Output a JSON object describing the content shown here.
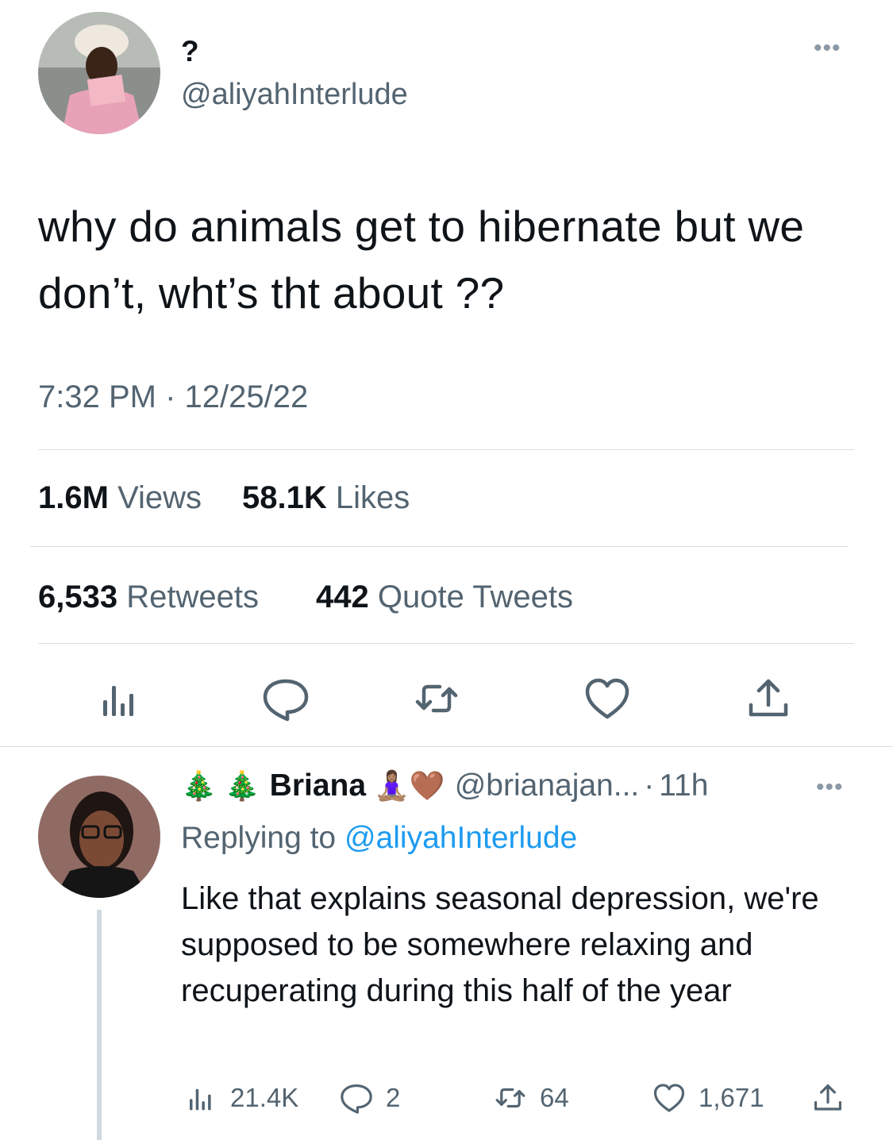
{
  "main_tweet": {
    "display_name": "?",
    "handle": "@aliyahInterlude",
    "text": "why do animals get to hibernate but we don’t, wht’s tht about ??",
    "time": "7:32 PM",
    "date": "12/25/22",
    "meta_separator": "·",
    "stats": {
      "views_count": "1.6M",
      "views_label": "Views",
      "likes_count": "58.1K",
      "likes_label": "Likes",
      "retweets_count": "6,533",
      "retweets_label": "Retweets",
      "quotes_count": "442",
      "quotes_label": "Quote Tweets"
    }
  },
  "reply_tweet": {
    "name_prefix_emoji": "🎄 🎄",
    "display_name": "Briana",
    "name_suffix_emoji": "🧘🏽‍♀️🤎",
    "handle": "@brianajan...",
    "separator": "·",
    "time_ago": "11h",
    "replying_label": "Replying to",
    "replying_to": "@aliyahInterlude",
    "text": "Like that explains seasonal depression, we're supposed to be somewhere relaxing and recuperating during this half of the year",
    "actions": {
      "views": "21.4K",
      "replies": "2",
      "retweets": "64",
      "likes": "1,671"
    }
  },
  "more_menu_glyph": "•••",
  "colors": {
    "text_primary": "#0f1419",
    "text_secondary": "#536471",
    "link": "#1d9bf0",
    "divider": "#d9dee3"
  },
  "icons": [
    "analytics-icon",
    "reply-icon",
    "retweet-icon",
    "like-icon",
    "share-icon"
  ]
}
